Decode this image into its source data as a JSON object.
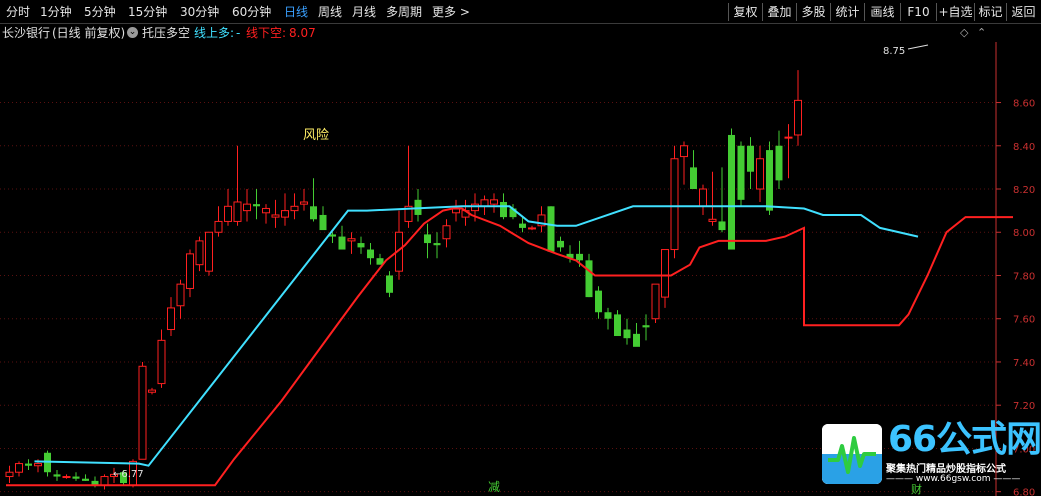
{
  "toolbar": {
    "periods": [
      "分时",
      "1分钟",
      "5分钟",
      "15分钟",
      "30分钟",
      "60分钟",
      "日线",
      "周线",
      "月线",
      "多周期",
      "更多 >"
    ],
    "active_period": "日线",
    "right_buttons": [
      "复权",
      "叠加",
      "多股",
      "统计",
      "画线",
      "F10",
      "+自选",
      "标记",
      "返回"
    ]
  },
  "infobar": {
    "stock_name": "长沙银行",
    "mode": "(日线 前复权)",
    "indicator_name": "托压多空",
    "line_up_label": "线上多:",
    "line_up_value": "-",
    "line_down_label": "线下空:",
    "line_down_value": "8.07"
  },
  "annotations": {
    "risk": "风险",
    "reduce": "减",
    "high_label": "8.75",
    "low_label": "6.77",
    "buy": "财"
  },
  "logo": {
    "title": "66公式网",
    "slogan": "聚集热门精品炒股指标公式",
    "url": "www.66gsw.com"
  },
  "colors": {
    "up": "#ff2020",
    "down": "#44cc33",
    "support_line": "#ff2020",
    "pressure_line": "#40e0ff",
    "axis": "#c83030",
    "highlight": "#3aa0ff"
  },
  "chart_data": {
    "type": "candlestick",
    "y_ticks": [
      "8.60",
      "8.40",
      "8.20",
      "8.00",
      "7.80",
      "7.60",
      "7.40",
      "7.20",
      "7.00",
      "6.80"
    ],
    "ylim": [
      6.78,
      8.88
    ],
    "candles": [
      [
        6.87,
        6.92,
        6.84,
        6.89
      ],
      [
        6.89,
        6.94,
        6.87,
        6.93
      ],
      [
        6.93,
        6.95,
        6.9,
        6.92
      ],
      [
        6.92,
        6.95,
        6.89,
        6.93
      ],
      [
        6.98,
        6.99,
        6.87,
        6.89
      ],
      [
        6.88,
        6.9,
        6.85,
        6.87
      ],
      [
        6.87,
        6.88,
        6.86,
        6.87
      ],
      [
        6.87,
        6.89,
        6.85,
        6.86
      ],
      [
        6.86,
        6.88,
        6.85,
        6.85
      ],
      [
        6.85,
        6.87,
        6.82,
        6.83
      ],
      [
        6.83,
        6.88,
        6.81,
        6.87
      ],
      [
        6.87,
        6.91,
        6.84,
        6.88
      ],
      [
        6.89,
        6.9,
        6.83,
        6.84
      ],
      [
        6.83,
        6.95,
        6.82,
        6.94
      ],
      [
        6.95,
        7.4,
        6.95,
        7.38
      ],
      [
        7.26,
        7.28,
        7.25,
        7.27
      ],
      [
        7.3,
        7.55,
        7.28,
        7.5
      ],
      [
        7.55,
        7.7,
        7.52,
        7.65
      ],
      [
        7.66,
        7.78,
        7.6,
        7.76
      ],
      [
        7.74,
        7.92,
        7.7,
        7.9
      ],
      [
        7.85,
        7.98,
        7.82,
        7.96
      ],
      [
        7.82,
        7.99,
        7.8,
        8.0
      ],
      [
        8.0,
        8.12,
        7.98,
        8.05
      ],
      [
        8.05,
        8.2,
        8.03,
        8.12
      ],
      [
        8.05,
        8.4,
        8.03,
        8.14
      ],
      [
        8.1,
        8.2,
        8.05,
        8.13
      ],
      [
        8.13,
        8.2,
        8.06,
        8.12
      ],
      [
        8.09,
        8.13,
        8.04,
        8.11
      ],
      [
        8.07,
        8.15,
        8.02,
        8.08
      ],
      [
        8.07,
        8.18,
        8.03,
        8.1
      ],
      [
        8.1,
        8.18,
        8.06,
        8.12
      ],
      [
        8.13,
        8.2,
        8.1,
        8.14
      ],
      [
        8.12,
        8.25,
        8.05,
        8.06
      ],
      [
        8.08,
        8.12,
        8.02,
        8.01
      ],
      [
        7.99,
        8.0,
        7.95,
        7.98
      ],
      [
        7.98,
        8.03,
        7.93,
        7.92
      ],
      [
        7.96,
        8.0,
        7.9,
        7.97
      ],
      [
        7.95,
        7.98,
        7.9,
        7.93
      ],
      [
        7.92,
        7.95,
        7.85,
        7.88
      ],
      [
        7.88,
        7.9,
        7.85,
        7.85
      ],
      [
        7.8,
        7.82,
        7.7,
        7.72
      ],
      [
        7.82,
        8.1,
        7.78,
        8.0
      ],
      [
        8.05,
        8.4,
        8.02,
        8.12
      ],
      [
        8.15,
        8.2,
        8.05,
        8.08
      ],
      [
        7.99,
        8.04,
        7.88,
        7.95
      ],
      [
        7.95,
        8.0,
        7.88,
        7.94
      ],
      [
        7.97,
        8.06,
        7.93,
        8.03
      ],
      [
        8.09,
        8.15,
        8.05,
        8.11
      ],
      [
        8.07,
        8.15,
        8.03,
        8.1
      ],
      [
        8.1,
        8.18,
        8.05,
        8.13
      ],
      [
        8.12,
        8.17,
        8.08,
        8.15
      ],
      [
        8.13,
        8.18,
        8.09,
        8.15
      ],
      [
        8.14,
        8.18,
        8.06,
        8.07
      ],
      [
        8.11,
        8.13,
        8.06,
        8.07
      ],
      [
        8.04,
        8.07,
        8.0,
        8.02
      ],
      [
        8.02,
        8.03,
        8.01,
        8.02
      ],
      [
        8.03,
        8.12,
        8.0,
        8.08
      ],
      [
        8.12,
        8.12,
        7.92,
        7.91
      ],
      [
        7.96,
        7.98,
        7.91,
        7.93
      ],
      [
        7.9,
        7.94,
        7.86,
        7.88
      ],
      [
        7.9,
        7.96,
        7.84,
        7.87
      ],
      [
        7.87,
        7.9,
        7.7,
        7.7
      ],
      [
        7.73,
        7.75,
        7.6,
        7.63
      ],
      [
        7.63,
        7.65,
        7.55,
        7.6
      ],
      [
        7.62,
        7.64,
        7.52,
        7.52
      ],
      [
        7.55,
        7.6,
        7.48,
        7.51
      ],
      [
        7.53,
        7.58,
        7.48,
        7.47
      ],
      [
        7.57,
        7.62,
        7.5,
        7.56
      ],
      [
        7.6,
        7.7,
        7.58,
        7.76
      ],
      [
        7.7,
        7.92,
        7.65,
        7.92
      ],
      [
        7.92,
        8.4,
        7.88,
        8.34
      ],
      [
        8.35,
        8.42,
        8.22,
        8.4
      ],
      [
        8.3,
        8.38,
        8.22,
        8.2
      ],
      [
        8.12,
        8.22,
        8.08,
        8.2
      ],
      [
        8.05,
        8.28,
        8.03,
        8.06
      ],
      [
        8.05,
        8.3,
        8.0,
        8.01
      ],
      [
        8.45,
        8.48,
        7.92,
        7.92
      ],
      [
        8.4,
        8.42,
        8.12,
        8.15
      ],
      [
        8.4,
        8.44,
        8.2,
        8.28
      ],
      [
        8.2,
        8.4,
        8.14,
        8.34
      ],
      [
        8.38,
        8.42,
        8.08,
        8.1
      ],
      [
        8.4,
        8.47,
        8.2,
        8.24
      ],
      [
        8.44,
        8.5,
        8.25,
        8.44
      ],
      [
        8.45,
        8.75,
        8.4,
        8.61
      ]
    ],
    "support_line": [
      [
        0,
        6.83
      ],
      [
        14,
        6.83
      ],
      [
        22,
        6.83
      ],
      [
        24,
        6.95
      ],
      [
        29,
        7.22
      ],
      [
        32,
        7.4
      ],
      [
        35,
        7.58
      ],
      [
        37,
        7.7
      ],
      [
        40,
        7.87
      ],
      [
        42,
        7.94
      ],
      [
        44,
        8.04
      ],
      [
        46,
        8.1
      ],
      [
        47,
        8.11
      ],
      [
        48,
        8.11
      ],
      [
        49,
        8.08
      ],
      [
        52,
        8.03
      ],
      [
        55,
        7.95
      ],
      [
        58,
        7.9
      ],
      [
        60,
        7.87
      ],
      [
        62,
        7.8
      ],
      [
        67,
        7.8
      ],
      [
        70,
        7.8
      ],
      [
        72,
        7.85
      ],
      [
        73,
        7.93
      ],
      [
        75,
        7.96
      ],
      [
        80,
        7.96
      ],
      [
        82,
        7.98
      ],
      [
        84,
        8.02
      ],
      [
        84,
        7.57
      ],
      [
        94,
        7.57
      ],
      [
        95,
        7.62
      ],
      [
        97,
        7.8
      ],
      [
        99,
        8.0
      ],
      [
        101,
        8.07
      ],
      [
        103,
        8.07
      ],
      [
        106,
        8.07
      ]
    ],
    "pressure_line": [
      [
        3,
        6.94
      ],
      [
        14,
        6.93
      ],
      [
        15,
        6.92
      ],
      [
        36,
        8.1
      ],
      [
        38,
        8.1
      ],
      [
        48,
        8.12
      ],
      [
        53,
        8.12
      ],
      [
        55,
        8.05
      ],
      [
        58,
        8.03
      ],
      [
        60,
        8.03
      ],
      [
        66,
        8.12
      ],
      [
        80,
        8.12
      ],
      [
        84,
        8.11
      ],
      [
        86,
        8.08
      ],
      [
        90,
        8.08
      ],
      [
        92,
        8.02
      ],
      [
        96,
        7.98
      ]
    ]
  }
}
